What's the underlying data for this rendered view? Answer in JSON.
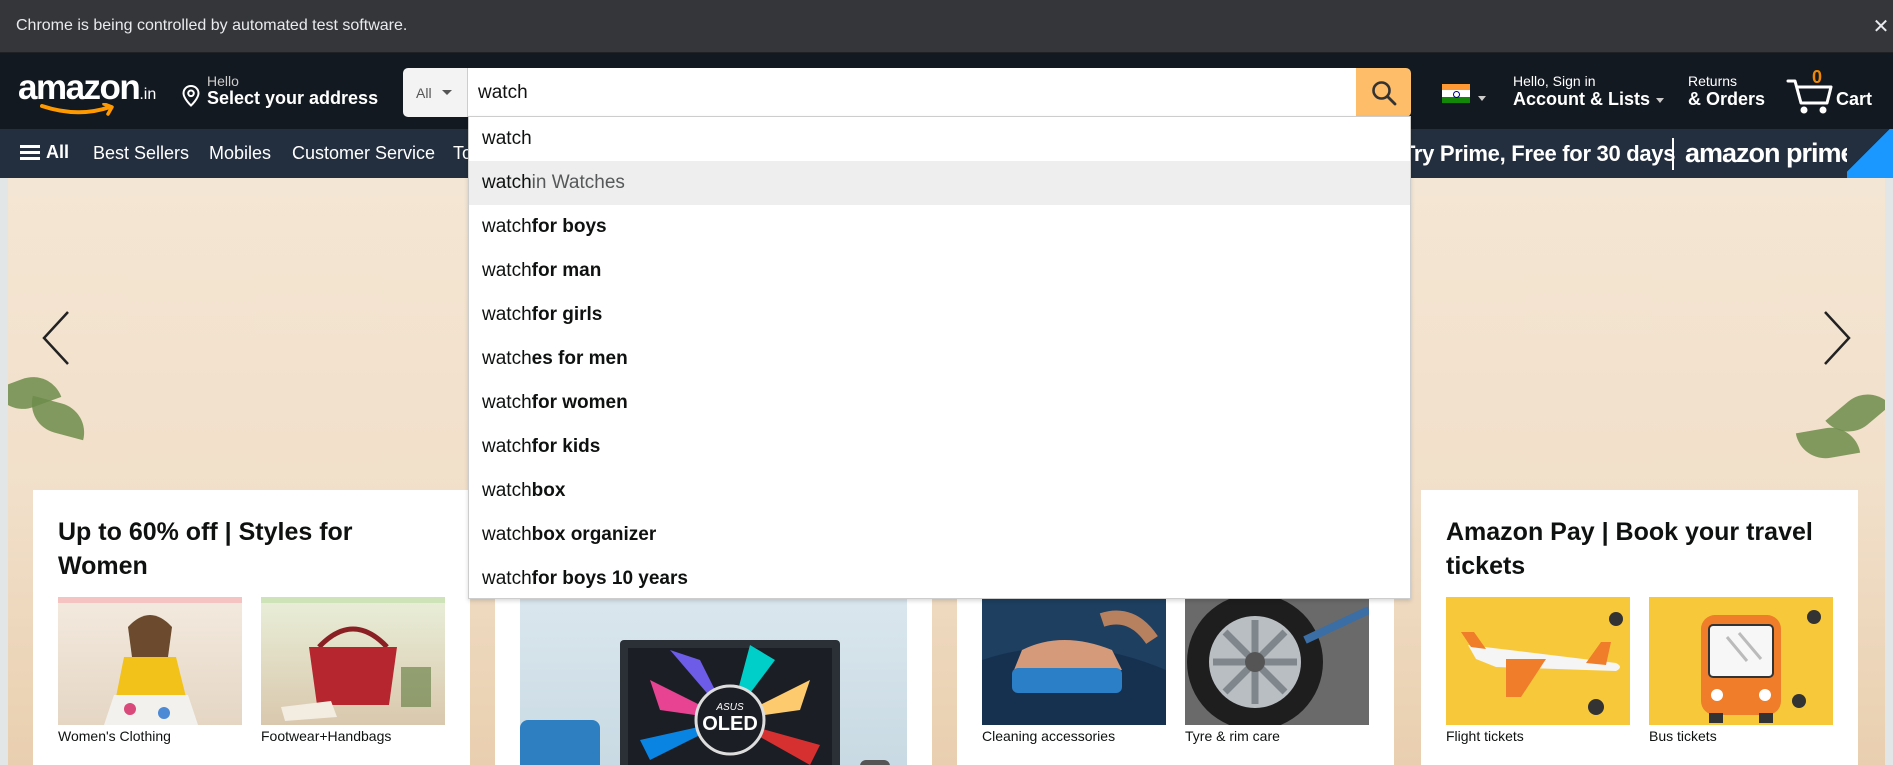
{
  "browser": {
    "automation_notice": "Chrome is being controlled by automated test software.",
    "close_symbol": "✕"
  },
  "header": {
    "logo_text": "amazon",
    "logo_tld": ".in",
    "address_line1": "Hello",
    "address_line2": "Select your address",
    "search_category": "All",
    "search_value": "watch",
    "account_line1": "Hello, Sign in",
    "account_line2": "Account & Lists",
    "orders_line1": "Returns",
    "orders_line2": "& Orders",
    "cart_count": "0",
    "cart_label": "Cart"
  },
  "nav": {
    "all_label": "All",
    "items": [
      "Best Sellers",
      "Mobiles",
      "Customer Service",
      "To"
    ],
    "prime_text": "Try Prime, Free for 30 days",
    "prime_brand": "amazon prime"
  },
  "suggestions": [
    {
      "prefix": "watch",
      "suffix": "",
      "dept": ""
    },
    {
      "prefix": "watch",
      "suffix": "",
      "dept": " in Watches"
    },
    {
      "prefix": "watch",
      "suffix": " for boys",
      "dept": ""
    },
    {
      "prefix": "watch",
      "suffix": " for man",
      "dept": ""
    },
    {
      "prefix": "watch",
      "suffix": " for girls",
      "dept": ""
    },
    {
      "prefix": "watch",
      "suffix": "es for men",
      "dept": ""
    },
    {
      "prefix": "watch",
      "suffix": " for women",
      "dept": ""
    },
    {
      "prefix": "watch",
      "suffix": " for kids",
      "dept": ""
    },
    {
      "prefix": "watch",
      "suffix": " box",
      "dept": ""
    },
    {
      "prefix": "watch",
      "suffix": " box organizer",
      "dept": ""
    },
    {
      "prefix": "watch",
      "suffix": " for boys 10 years",
      "dept": ""
    }
  ],
  "cards": {
    "women": {
      "title": "Up to 60% off | Styles for Women",
      "tiles": [
        "Women's Clothing",
        "Footwear+Handbags"
      ]
    },
    "laptop": {
      "oled_brand": "ASUS",
      "oled_text": "OLED"
    },
    "car": {
      "tiles": [
        "Cleaning accessories",
        "Tyre & rim care"
      ]
    },
    "travel": {
      "title": "Amazon Pay | Book your travel tickets",
      "tiles": [
        "Flight tickets",
        "Bus tickets"
      ]
    }
  },
  "colors": {
    "nav_top": "#131921",
    "nav_main": "#232f3e",
    "search_button": "#febd69",
    "cart_count": "#f08804",
    "travel_tile": "#f7c93a"
  }
}
